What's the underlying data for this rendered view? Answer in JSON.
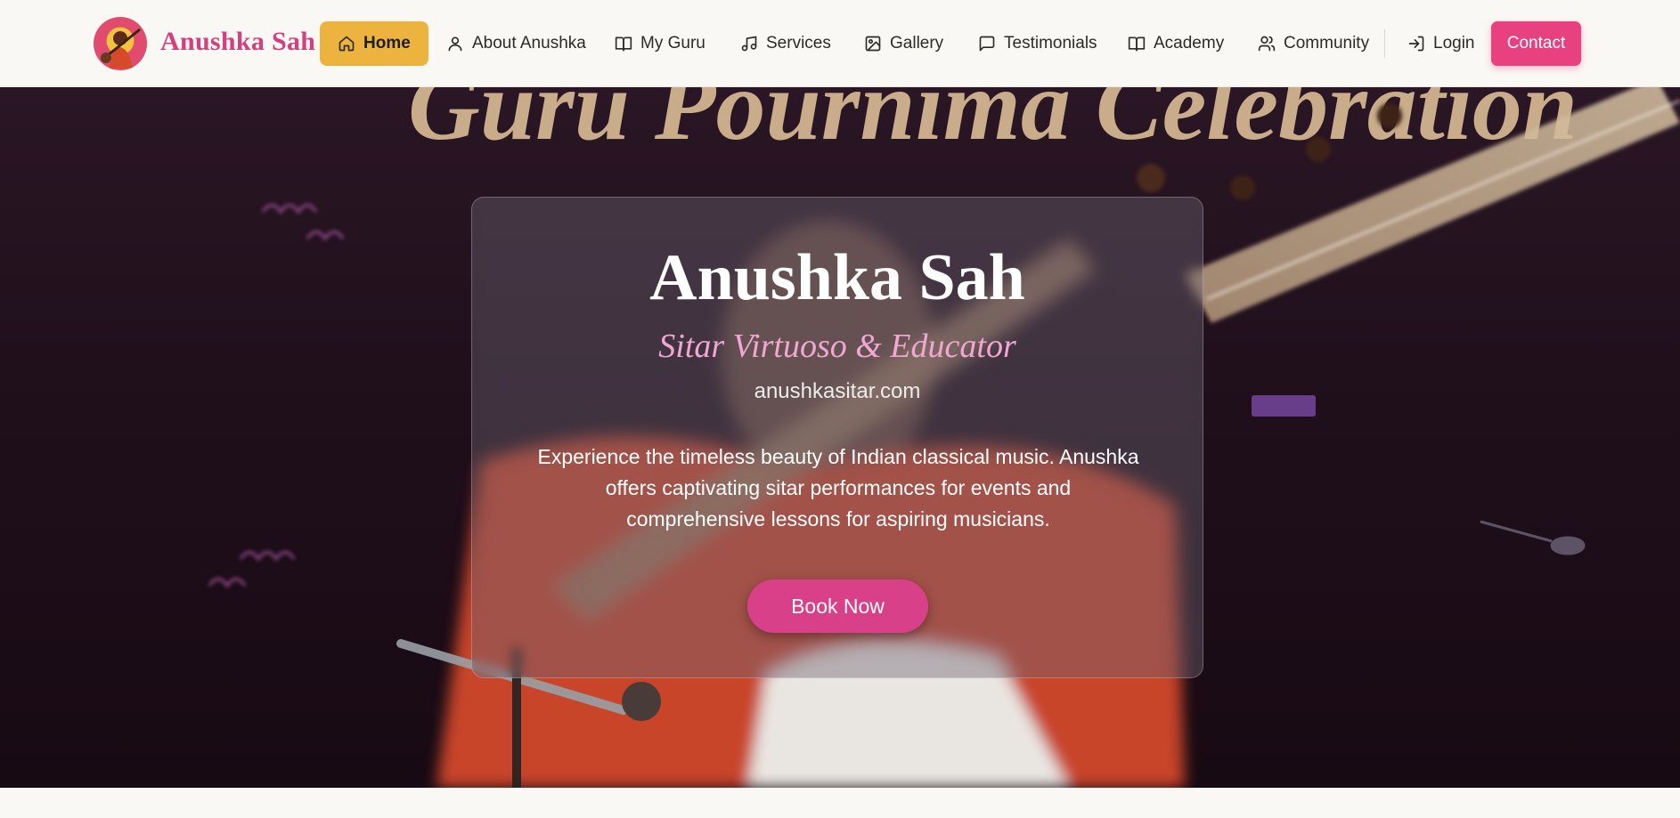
{
  "brand": {
    "name": "Anushka Sah",
    "logo_icon": "sitar-player-avatar"
  },
  "nav": {
    "items": [
      {
        "label": "Home",
        "icon": "home-icon",
        "active": true
      },
      {
        "label": "About Anushka",
        "icon": "user-icon"
      },
      {
        "label": "My Guru",
        "icon": "book-open-icon"
      },
      {
        "label": "Services",
        "icon": "music-note-icon"
      },
      {
        "label": "Gallery",
        "icon": "image-icon"
      },
      {
        "label": "Testimonials",
        "icon": "message-square-icon"
      },
      {
        "label": "Academy",
        "icon": "book-open-icon"
      },
      {
        "label": "Community",
        "icon": "users-icon"
      },
      {
        "label": "Login",
        "icon": "log-in-icon"
      }
    ],
    "contact_label": "Contact"
  },
  "hero": {
    "banner_text": "Guru Pournima Celebration",
    "title": "Anushka Sah",
    "subtitle": "Sitar Virtuoso & Educator",
    "website": "anushkasitar.com",
    "description": "Experience the timeless beauty of Indian classical music. Anushka offers captivating sitar performances for events and comprehensive lessons for aspiring musicians.",
    "cta_label": "Book Now"
  },
  "colors": {
    "brand_pink": "#d4407e",
    "home_active_bg": "#ecb43f",
    "contact_bg": "#e8417f",
    "book_now_bg": "#d9408a",
    "subtitle_pink": "#f1a7d2",
    "page_bg": "#faf8f4"
  }
}
